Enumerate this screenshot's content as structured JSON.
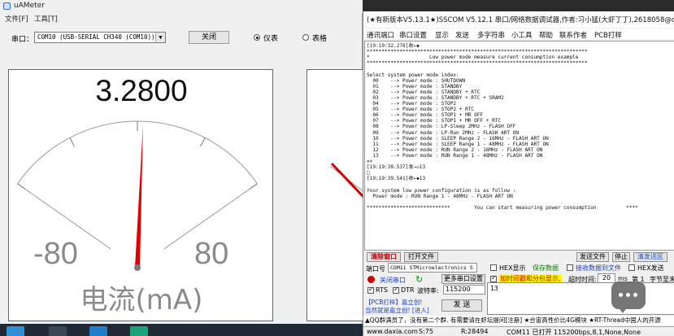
{
  "uameter": {
    "title": "uAMeter",
    "menu": [
      "文件[F]",
      "工具[T]"
    ],
    "port_label": "串口：",
    "port_value": "COM10 (USB-SERIAL CH340 (COM10))",
    "close_button": "关闭",
    "mode_gauge": "仪表",
    "mode_table": "表格",
    "gauge": {
      "value_text": "3.2800",
      "min_label": "-80",
      "max_label": "80",
      "unit_label": "电流(mA)",
      "scale_min": -80,
      "scale_max": 80,
      "needle_value": 3.28
    }
  },
  "sscom": {
    "title": "(★有新版本V5.13.1★)SSCOM V5.12.1 串口/网络数据调试器,作者:习小猛(大虾丁丁),2618058@qq.com",
    "menu": [
      "通讯端口",
      "串口设置",
      "显示",
      "发送",
      "多字符串",
      "小工具",
      "帮助",
      "联系作者",
      "PCB打样"
    ],
    "output_lines": [
      "[19:19:32.278]收←◆",
      "**************************************************************************",
      "*                    Low power mode measure current consumption example",
      "**************************************************************************",
      "",
      "Select system power mode index:",
      "  00    --> Power mode : SHUTDOWN",
      "  01    --> Power mode : STANDBY",
      "  02    --> Power mode : STANDBY + RTC",
      "  03    --> Power mode : STANDBY + RTC + SRAM2",
      "  04    --> Power mode : STOP2",
      "  05    --> Power mode : STOP2 + RTC",
      "  06    --> Power mode : STOP1 + MR OFF",
      "  07    --> Power mode : STOP1 + MR OFF + RTC",
      "  08    --> Power mode : LP-Sleep 2MHz - FLASH OFF",
      "  09    --> Power mode : LP-Run 2MHz - FLASH ART ON",
      "  10    --> Power mode : SLEEP Range 2 - 16MHz - FLASH ART ON",
      "  11    --> Power mode : SLEEP Range 1 - 48MHz - FLASH ART ON",
      "  12    --> Power mode : RUN Range 2 - 16MHz - FLASH ART ON",
      "  13    --> Power mode : RUN Range 1 - 48MHz - FLASH ART ON",
      "=>",
      "[19:19:39.537]发→◇13",
      "□",
      "[19:19:39.541]收←◆13",
      "",
      "Your system low power configuration is as follow :",
      "  Power mode : RUN Range 1 - 48MHz - FLASH ART ON",
      "",
      "****************************        You can start measuring power consumption          ****"
    ],
    "clear_window": "清除窗口",
    "open_file": "打开文件",
    "send_file": "发送文件",
    "stop": "停止",
    "clear_send_area": "清发送区",
    "port_no_label": "端口号",
    "port_no_value": "COM11 STMicroelectronics S",
    "hex_display": "HEX显示",
    "save_data": "保存数据",
    "receive_to_file": "接收数据到文件",
    "hex_send": "HEX发送",
    "close_port": "关闭串口",
    "more_settings": "更多串口设置",
    "add_timestamp": "加时间戳和分包显示,",
    "timeout_label": "超时时间:",
    "timeout_value": "20",
    "timeout_unit": "ms",
    "byte_label": "第 1",
    "byte_suffix": "字节至末",
    "rts": "RTS",
    "dtr": "DTR",
    "baud_label": "波特率:",
    "baud_value": "115200",
    "send_input": "13",
    "promo_1": "【PCB打样】嘉立创!",
    "promo_2": "当然就是嘉立创! [进入]",
    "send_button": "发 送",
    "ticker": "▲QQ群满员了，没有第二个群. 有需要请在虾坛提问[注册] ★合宙高性价比4G模块 ★RT-Thread中国人的开源",
    "status": {
      "site": "www.daxia.com",
      "s": "S:75",
      "r": "R:28494",
      "port_state": "COM11 已打开  115200bps,8,1,None,None"
    }
  }
}
